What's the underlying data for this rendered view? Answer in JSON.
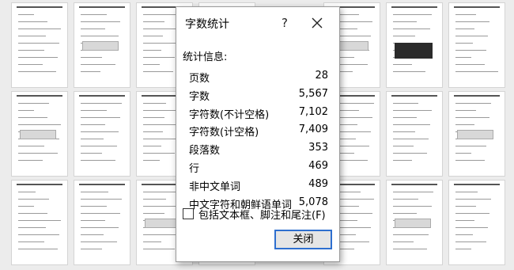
{
  "dialog": {
    "title": "字数统计",
    "help_label": "?",
    "section_label": "统计信息:",
    "stats": [
      {
        "label": "页数",
        "value": "28"
      },
      {
        "label": "字数",
        "value": "5,567"
      },
      {
        "label": "字符数(不计空格)",
        "value": "7,102"
      },
      {
        "label": "字符数(计空格)",
        "value": "7,409"
      },
      {
        "label": "段落数",
        "value": "353"
      },
      {
        "label": "行",
        "value": "469"
      },
      {
        "label": "非中文单词",
        "value": "489"
      },
      {
        "label": "中文字符和朝鲜语单词",
        "value": "5,078"
      }
    ],
    "include_checkbox": {
      "label": "包括文本框、脚注和尾注(F)",
      "checked": false
    },
    "close_button_label": "关闭"
  },
  "background": {
    "page_count_visible": 24
  },
  "colors": {
    "accent": "#2e6fcf",
    "background": "#ececec"
  }
}
